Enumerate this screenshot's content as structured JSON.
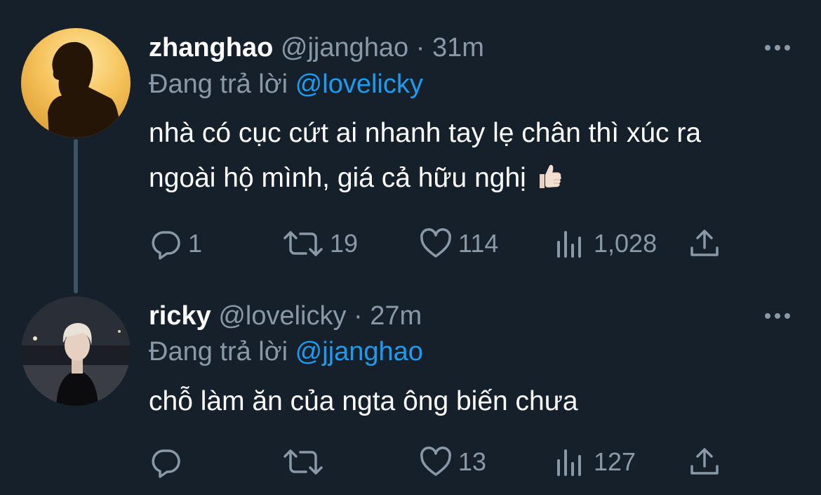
{
  "tweets": [
    {
      "name": "zhanghao",
      "handle": "@jjanghao",
      "separator": "·",
      "time": "31m",
      "replying_prefix": "Đang trả lời",
      "replying_to": "@lovelicky",
      "text_line1": "nhà có cục cứt ai nhanh tay lẹ chân thì xúc ra",
      "text_line2": "ngoài hộ mình, giá cả hữu nghị",
      "emoji": "thumbs-up",
      "replies": "1",
      "retweets": "19",
      "likes": "114",
      "views": "1,028"
    },
    {
      "name": "ricky",
      "handle": "@lovelicky",
      "separator": "·",
      "time": "27m",
      "replying_prefix": "Đang trả lời",
      "replying_to": "@jjanghao",
      "text_line1": "chỗ làm ăn của ngta ông biến chưa",
      "replies": "",
      "retweets": "",
      "likes": "13",
      "views": "127"
    }
  ],
  "colors": {
    "background": "#15202b",
    "text": "#ffffff",
    "secondary": "#8b98a5",
    "link": "#1d9bf0",
    "thread_line": "#3d5466"
  },
  "icons": [
    "reply-icon",
    "retweet-icon",
    "like-icon",
    "views-icon",
    "share-icon",
    "more-icon"
  ]
}
